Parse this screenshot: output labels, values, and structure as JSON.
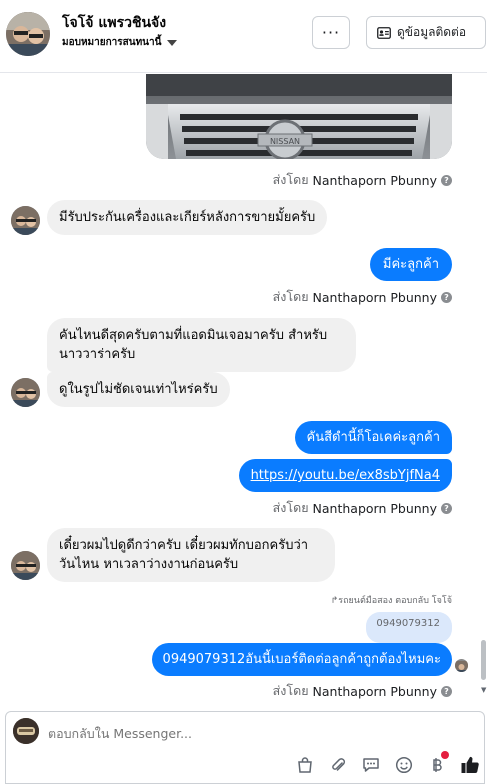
{
  "header": {
    "contact_name": "โจโจ้ แพรวชินจัง",
    "assign_label": "มอบหมายการสนทนานี้",
    "more_label": "···",
    "view_contact_label": "ดูข้อมูลติดต่อ"
  },
  "messages": {
    "sent_by_prefix": "ส่งโดย",
    "sender_name": "Nanthaporn Pbunny",
    "help_glyph": "?",
    "msg_in_1": "มีรับประกันเครื่องและเกียร์หลังการขายมั้ยครับ",
    "msg_out_1": "มีค่ะลูกค้า",
    "msg_in_2": "คันไหนดีสุดครับตามที่แอดมินเจอมาครับ สำหรับนาววาร่าครับ",
    "msg_in_3": "ดูในรูปไม่ชัดเจนเท่าไหร่ครับ",
    "msg_out_2": "คันสีดำนี้ก็โอเคค่ะลูกค้า",
    "msg_out_3": "https://youtu.be/ex8sbYjfNa4",
    "msg_in_4": "เดี๋ยวผมไปดูดีกว่าครับ เดี๋ยวผมทักบอกครับว่าวันไหน หาเวลาว่างงานก่อนครับ",
    "reply_label": "↱รถยนต์มือสอง ตอบกลับ โจโจ้",
    "quoted_text": "0949079312",
    "msg_out_4": "0949079312อันนี้เบอร์ติดต่อลูกค้าถูกต้องไหมคะ"
  },
  "composer": {
    "placeholder": "ตอบกลับใน Messenger..."
  },
  "colors": {
    "bubble_out": "#0a7cff",
    "bubble_in": "#f0f0f0",
    "muted_text": "#65676b"
  },
  "icons": [
    "ellipsis-icon",
    "contact-card-icon",
    "caret-down-icon",
    "help-icon",
    "shopping-bag-icon",
    "paperclip-icon",
    "chat-bubble-icon",
    "emoji-icon",
    "baht-icon",
    "thumbs-up-icon"
  ]
}
